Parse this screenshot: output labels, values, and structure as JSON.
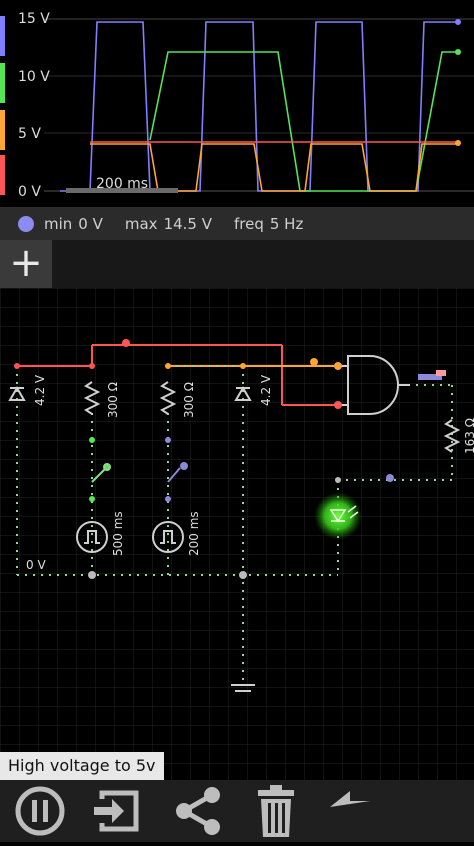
{
  "scope": {
    "y_labels": [
      "15 V",
      "10 V",
      "5 V",
      "0 V"
    ],
    "time_label": "200 ms",
    "info": {
      "min_label": "min",
      "min_value": "0 V",
      "max_label": "max",
      "max_value": "14.5 V",
      "freq_label": "freq",
      "freq_value": "5 Hz"
    },
    "colors": {
      "blue": "#8080ff",
      "green": "#55e455",
      "orange": "#ffa533",
      "red": "#ff5555"
    }
  },
  "add_button": "+",
  "circuit": {
    "labels": {
      "diode_left": "4.2 V",
      "resistor_left": "300 Ω",
      "resistor_mid": "300 Ω",
      "diode_mid": "4.2 V",
      "resistor_right": "163 Ω",
      "clock_left": "500 ms",
      "clock_mid": "200 ms",
      "ground_label": "0 V"
    }
  },
  "status_text": "High voltage to 5v",
  "toolbar": {
    "pause": "pause-icon",
    "import": "import-icon",
    "share": "share-icon",
    "delete": "trash-icon",
    "undo": "undo-icon"
  }
}
